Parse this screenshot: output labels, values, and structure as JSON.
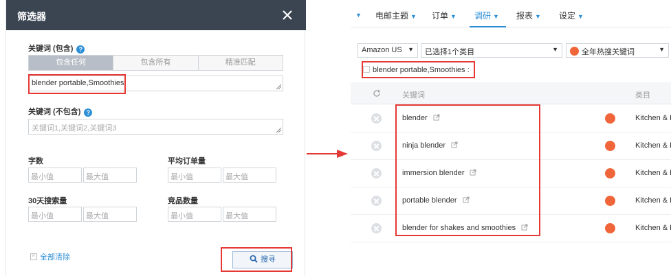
{
  "filter_dialog": {
    "title": "筛选器",
    "include_label": "关键词 (包含)",
    "match_tabs": [
      {
        "label": "包含任何",
        "active": true
      },
      {
        "label": "包含所有",
        "active": false
      },
      {
        "label": "精准匹配",
        "active": false
      }
    ],
    "include_value": "blender portable,Smoothies",
    "exclude_label": "关键词 (不包含)",
    "exclude_placeholder": "关键词1,关键词2,关键词3",
    "word_count_label": "字数",
    "avg_orders_label": "平均订单量",
    "search_volume_label": "30天搜索量",
    "competitor_count_label": "竞品数量",
    "min_placeholder": "最小值",
    "max_placeholder": "最大值",
    "clear_all_label": "全部清除",
    "search_button_label": "搜寻"
  },
  "app": {
    "nav": [
      {
        "label": "电邮主题",
        "active": false
      },
      {
        "label": "订单",
        "active": false
      },
      {
        "label": "调研",
        "active": true
      },
      {
        "label": "报表",
        "active": false
      },
      {
        "label": "设定",
        "active": false
      }
    ],
    "marketplace_select": "Amazon US",
    "category_select": "已选择1个类目",
    "hot_keywords_select": "全年热搜关键词",
    "keyword_tag": "blender portable,Smoothies :",
    "columns": {
      "keyword": "关键词",
      "category": "类目"
    },
    "rows": [
      {
        "keyword": "blender",
        "category": "Kitchen & D"
      },
      {
        "keyword": "ninja blender",
        "category": "Kitchen & D"
      },
      {
        "keyword": "immersion blender",
        "category": "Kitchen & D"
      },
      {
        "keyword": "portable blender",
        "category": "Kitchen & D"
      },
      {
        "keyword": "blender for shakes and smoothies",
        "category": "Kitchen & D"
      }
    ]
  },
  "colors": {
    "header_bg": "#3b4552",
    "accent_blue": "#2c8ed6",
    "highlight_red": "#e53935",
    "hot_orange": "#f0663a"
  }
}
